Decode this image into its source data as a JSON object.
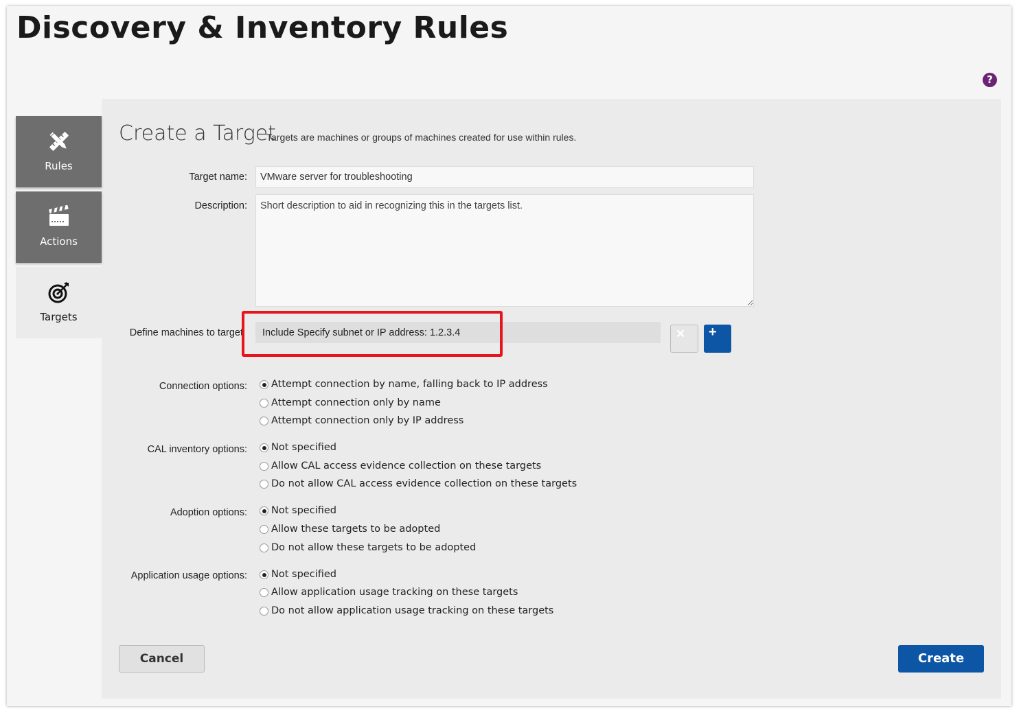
{
  "page": {
    "title": "Discovery & Inventory Rules",
    "help_icon": "question-mark-icon"
  },
  "sidebar": {
    "items": [
      {
        "label": "Rules",
        "icon": "pencil-ruler-icon",
        "active": false
      },
      {
        "label": "Actions",
        "icon": "clapperboard-icon",
        "active": false
      },
      {
        "label": "Targets",
        "icon": "target-icon",
        "active": true
      }
    ]
  },
  "form": {
    "title": "Create a Target",
    "subtitle": "Targets are machines or groups of machines created for use within rules.",
    "target_name": {
      "label": "Target name:",
      "value": "VMware server for troubleshooting"
    },
    "description": {
      "label": "Description:",
      "placeholder": "Short description to aid in recognizing this in the targets list."
    },
    "define_machines": {
      "label": "Define machines to target",
      "entry": "Include Specify subnet or IP address: 1.2.3.4",
      "remove_icon": "close-icon",
      "add_icon": "plus-icon"
    },
    "connection_options": {
      "label": "Connection options:",
      "options": [
        "Attempt connection by name, falling back to IP address",
        "Attempt connection only by name",
        "Attempt connection only by IP address"
      ],
      "selected": 0
    },
    "cal_options": {
      "label": "CAL inventory options:",
      "options": [
        "Not specified",
        "Allow CAL access evidence collection on these targets",
        "Do not allow CAL access evidence collection on these targets"
      ],
      "selected": 0
    },
    "adoption_options": {
      "label": "Adoption options:",
      "options": [
        "Not specified",
        "Allow these targets to be adopted",
        "Do not allow these targets to be adopted"
      ],
      "selected": 0
    },
    "app_usage_options": {
      "label": "Application usage options:",
      "options": [
        "Not specified",
        "Allow application usage tracking on these targets",
        "Do not allow application usage tracking on these targets"
      ],
      "selected": 0
    },
    "cancel_label": "Cancel",
    "create_label": "Create"
  },
  "colors": {
    "primary_button": "#0c56a5",
    "highlight": "#e8141b",
    "help_icon": "#6b2374",
    "sidebar_tab": "#6e6e6e"
  }
}
